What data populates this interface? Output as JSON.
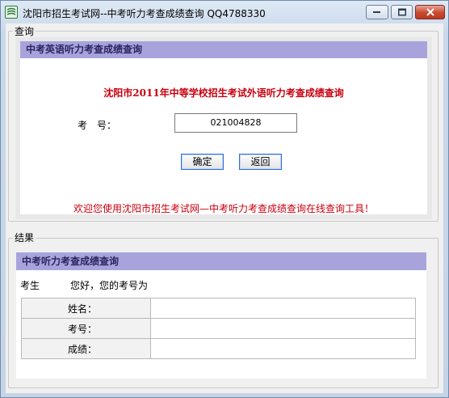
{
  "window": {
    "title": "沈阳市招生考试网--中考听力考查成绩查询 QQ4788330"
  },
  "query": {
    "group_label": "查询",
    "header": "中考英语听力考查成绩查询",
    "main_title": "沈阳市2011年中等学校招生考试外语听力考查成绩查询",
    "id_label": "考　号：",
    "id_value": "021004828",
    "confirm_label": "确定",
    "back_label": "返回",
    "welcome": "欢迎您使用沈阳市招生考试网—中考听力考查成绩查询在线查询工具！"
  },
  "result": {
    "group_label": "结果",
    "header": "中考听力考查成绩查询",
    "greet_prefix": "考生",
    "greet_text": "您好，您的考号为",
    "rows": [
      {
        "label": "姓名：",
        "value": ""
      },
      {
        "label": "考号：",
        "value": ""
      },
      {
        "label": "成绩：",
        "value": ""
      }
    ]
  },
  "colors": {
    "header_bg": "#a8a4db",
    "accent_red": "#c8000e"
  }
}
